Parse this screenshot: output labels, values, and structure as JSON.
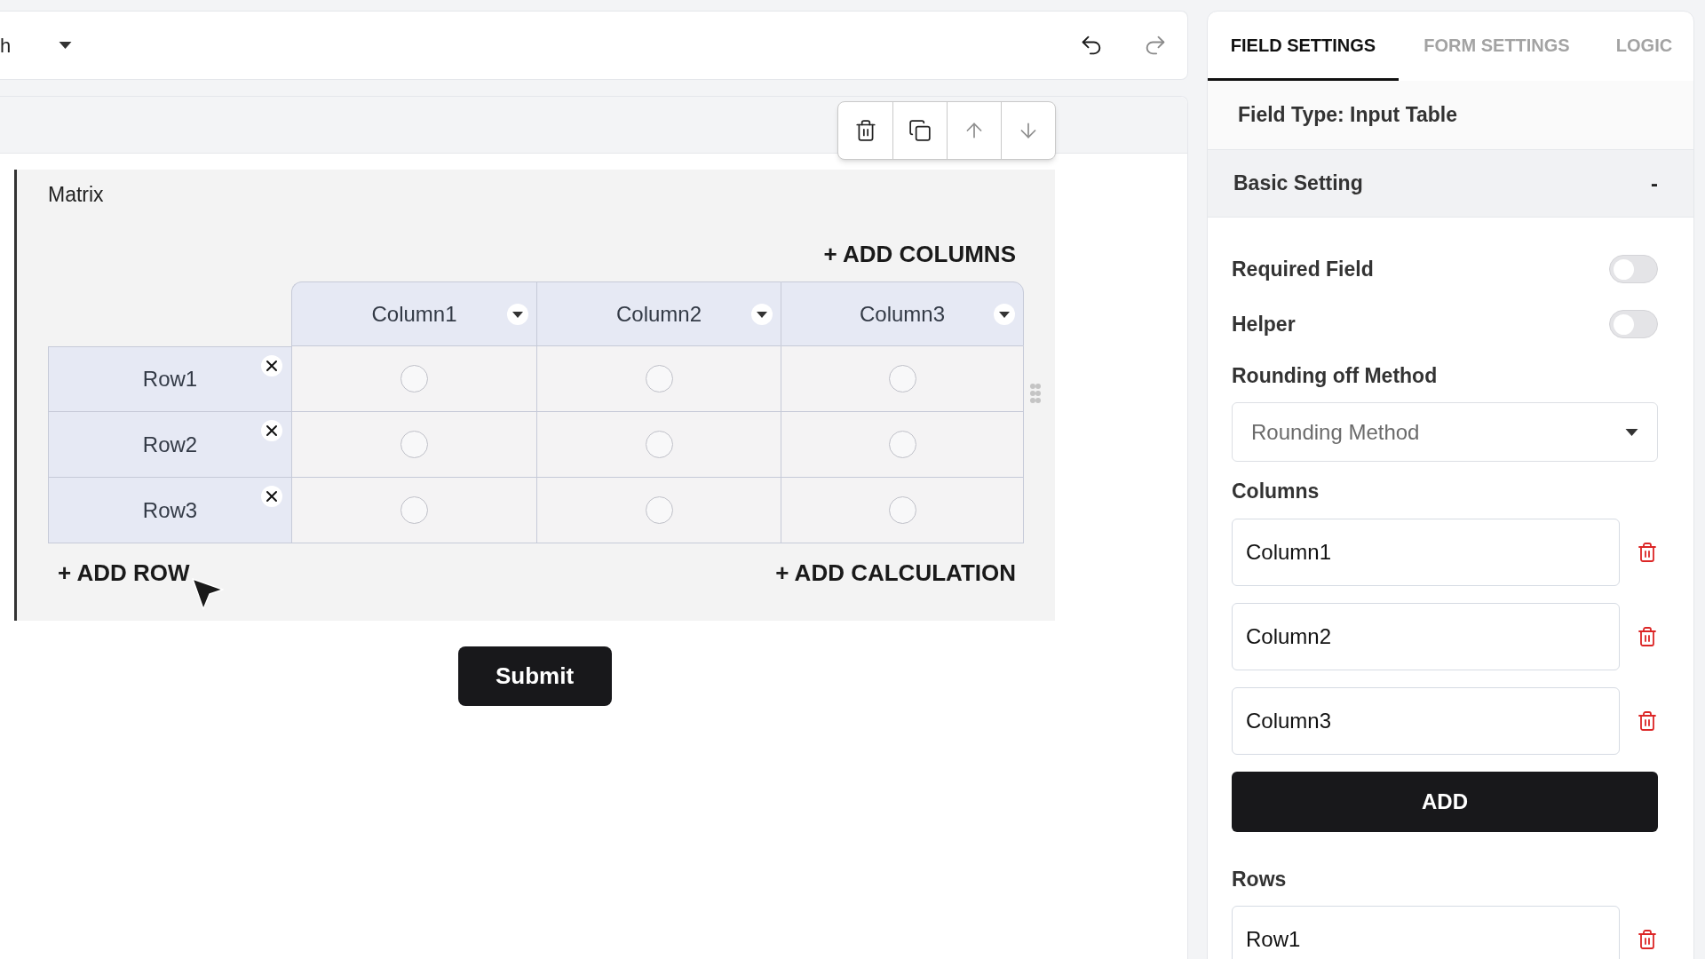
{
  "top_bar": {
    "language": "h",
    "actions": [
      {
        "kind": "undo",
        "disabled": false
      },
      {
        "kind": "redo",
        "disabled": true
      }
    ]
  },
  "field_toolbar": [
    {
      "kind": "delete",
      "disabled": false
    },
    {
      "kind": "duplicate",
      "disabled": false
    },
    {
      "kind": "move_up",
      "disabled": true
    },
    {
      "kind": "move_down",
      "disabled": true
    }
  ],
  "matrix": {
    "label": "Matrix",
    "add_columns": "+ ADD COLUMNS",
    "columns": [
      "Column1",
      "Column2",
      "Column3"
    ],
    "rows": [
      {
        "label": "Row1",
        "cells": [
          {
            "selected": false
          },
          {
            "selected": false
          },
          {
            "selected": false
          }
        ]
      },
      {
        "label": "Row2",
        "cells": [
          {
            "selected": false
          },
          {
            "selected": false
          },
          {
            "selected": false
          }
        ]
      },
      {
        "label": "Row3",
        "cells": [
          {
            "selected": false
          },
          {
            "selected": false
          },
          {
            "selected": false
          }
        ]
      }
    ],
    "add_row": "+ ADD ROW",
    "add_calculation": "+ ADD CALCULATION"
  },
  "submit": "Submit",
  "settings_panel": {
    "tabs": [
      {
        "label": "FIELD SETTINGS",
        "selected": true
      },
      {
        "label": "FORM SETTINGS",
        "selected": false
      },
      {
        "label": "LOGIC",
        "selected": false
      }
    ],
    "field_type": "Field Type: Input Table",
    "section": {
      "title": "Basic Setting",
      "symbol": "-"
    },
    "toggles": [
      {
        "label": "Required Field",
        "on": false
      },
      {
        "label": "Helper",
        "on": false
      }
    ],
    "rounding": {
      "label": "Rounding off Method",
      "placeholder": "Rounding Method"
    },
    "columns": {
      "label": "Columns",
      "items": [
        "Column1",
        "Column2",
        "Column3"
      ]
    },
    "add_button": "ADD",
    "rows": {
      "label": "Rows",
      "items": [
        "Row1"
      ]
    }
  }
}
